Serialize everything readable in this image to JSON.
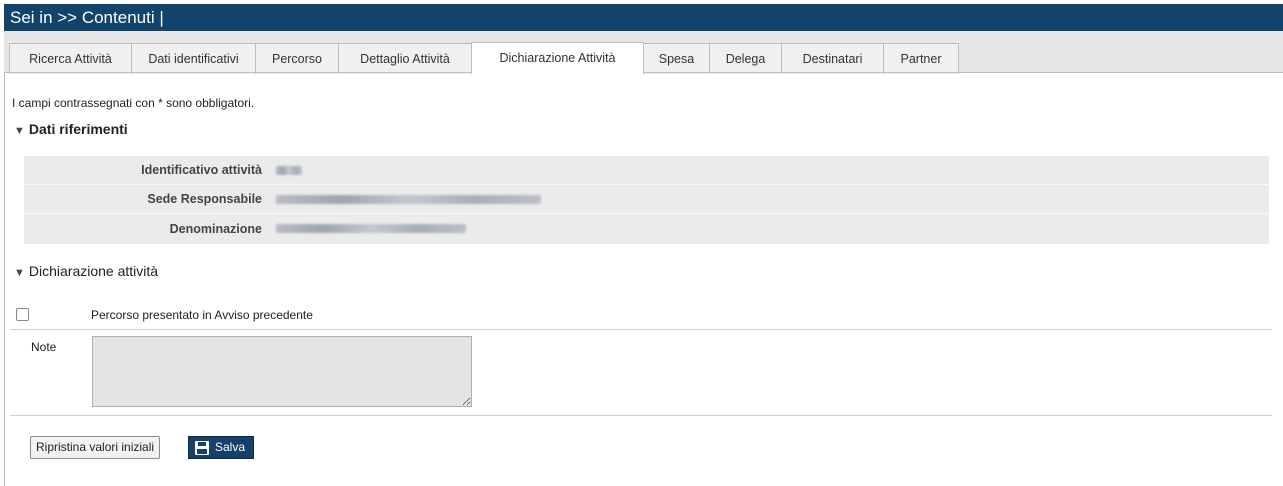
{
  "breadcrumb": "Sei in >> Contenuti |",
  "tabs": [
    {
      "label": "Ricerca Attività"
    },
    {
      "label": "Dati identificativi"
    },
    {
      "label": "Percorso"
    },
    {
      "label": "Dettaglio Attività"
    },
    {
      "label": "Dichiarazione Attività",
      "active": true
    },
    {
      "label": "Spesa"
    },
    {
      "label": "Delega"
    },
    {
      "label": "Destinatari"
    },
    {
      "label": "Partner"
    }
  ],
  "required_note": "I campi contrassegnati con * sono obbligatori.",
  "section_refs": {
    "title": "Dati riferimenti",
    "rows": [
      {
        "label": "Identificativo attività",
        "value_note": "redacted"
      },
      {
        "label": "Sede Responsabile",
        "value_note": "redacted"
      },
      {
        "label": "Denominazione",
        "value_note": "redacted"
      }
    ]
  },
  "section_decl": {
    "title": "Dichiarazione attività",
    "checkbox_label": "Percorso presentato in Avviso precedente",
    "checkbox_checked": false,
    "note_label": "Note",
    "note_value": ""
  },
  "buttons": {
    "reset_label": "Ripristina valori iniziali",
    "save_label": "Salva"
  }
}
